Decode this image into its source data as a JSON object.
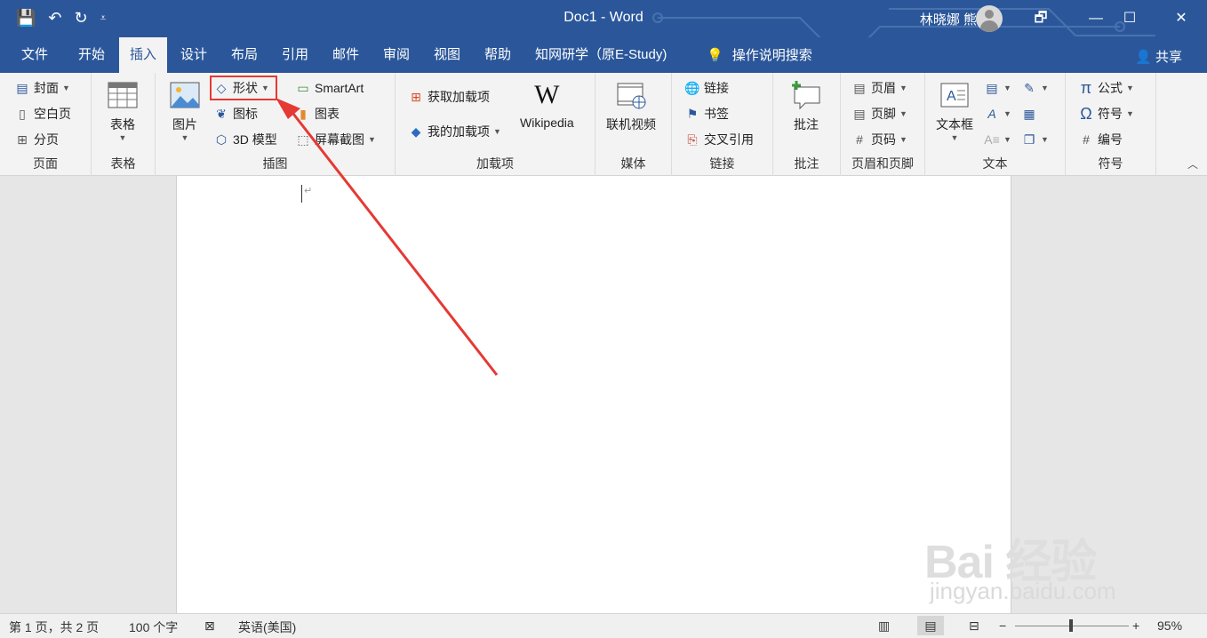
{
  "titlebar": {
    "doc_title": "Doc1  -  Word",
    "user": "林晓娜 熊禹",
    "qat": {
      "save_icon": "💾",
      "undo_icon": "↶",
      "redo_icon": "↻",
      "customize_icon": "⩡"
    },
    "win": {
      "restore_icon": "🗗",
      "minimize_icon": "—",
      "maximize_icon": "☐",
      "close_icon": "✕"
    }
  },
  "tabs": [
    "文件",
    "开始",
    "插入",
    "设计",
    "布局",
    "引用",
    "邮件",
    "审阅",
    "视图",
    "帮助",
    "知网研学（原E-Study)"
  ],
  "active_tab": "插入",
  "tell_me": "操作说明搜索",
  "share": "共享",
  "ribbon": {
    "pages": {
      "label": "页面",
      "cover": "封面",
      "blank": "空白页",
      "break": "分页"
    },
    "tables": {
      "label": "表格",
      "table": "表格"
    },
    "illustrations": {
      "label": "插图",
      "pictures": "图片",
      "shapes": "形状",
      "icons": "图标",
      "model3d": "3D 模型",
      "smartart": "SmartArt",
      "chart": "图表",
      "screenshot": "屏幕截图"
    },
    "addins": {
      "label": "加载项",
      "get": "获取加载项",
      "my": "我的加载项",
      "wikipedia": "Wikipedia",
      "wiki_logo": "W"
    },
    "media": {
      "label": "媒体",
      "video": "联机视频"
    },
    "links": {
      "label": "链接",
      "link": "链接",
      "bookmark": "书签",
      "crossref": "交叉引用"
    },
    "comments": {
      "label": "批注",
      "comment": "批注"
    },
    "header_footer": {
      "label": "页眉和页脚",
      "header": "页眉",
      "footer": "页脚",
      "page_number": "页码"
    },
    "text": {
      "label": "文本",
      "textbox": "文本框"
    },
    "symbols": {
      "label": "符号",
      "equation": "公式",
      "symbol": "符号",
      "number": "编号",
      "pi": "π",
      "omega": "Ω"
    }
  },
  "document": {
    "para_mark": "↵"
  },
  "status": {
    "page": "第 1 页，共 2 页",
    "words": "100 个字",
    "language": "英语(美国)",
    "zoom": "95%"
  },
  "watermark": {
    "main": "Bai 经验",
    "sub": "jingyan.baidu.com"
  }
}
